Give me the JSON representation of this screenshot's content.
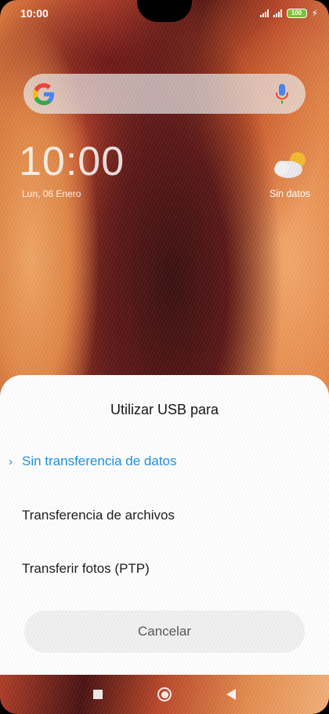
{
  "status_bar": {
    "time": "10:00",
    "battery": "100",
    "icons": [
      "signal-icon",
      "signal-icon",
      "battery-icon",
      "charging-icon"
    ]
  },
  "search_bar": {
    "icons": [
      "google-logo-icon",
      "microphone-icon"
    ]
  },
  "lock_clock": {
    "time": "10:00",
    "date": "Lun, 06 Enero"
  },
  "weather": {
    "icon": "partly-cloudy-icon",
    "text": "Sin datos"
  },
  "usb_dialog": {
    "title": "Utilizar USB para",
    "selected_marker": "›",
    "options": [
      {
        "label": "Sin transferencia de datos",
        "selected": true
      },
      {
        "label": "Transferencia de archivos",
        "selected": false
      },
      {
        "label": "Transferir fotos (PTP)",
        "selected": false
      }
    ],
    "cancel_label": "Cancelar"
  },
  "nav_bar": {
    "icons": [
      "recents-square-icon",
      "home-circle-icon",
      "back-triangle-icon"
    ]
  },
  "colors": {
    "accent": "#1c8fdb",
    "battery": "#7cc13b",
    "sheet_bg": "#ffffff",
    "cancel_bg": "#f1f1f1"
  }
}
